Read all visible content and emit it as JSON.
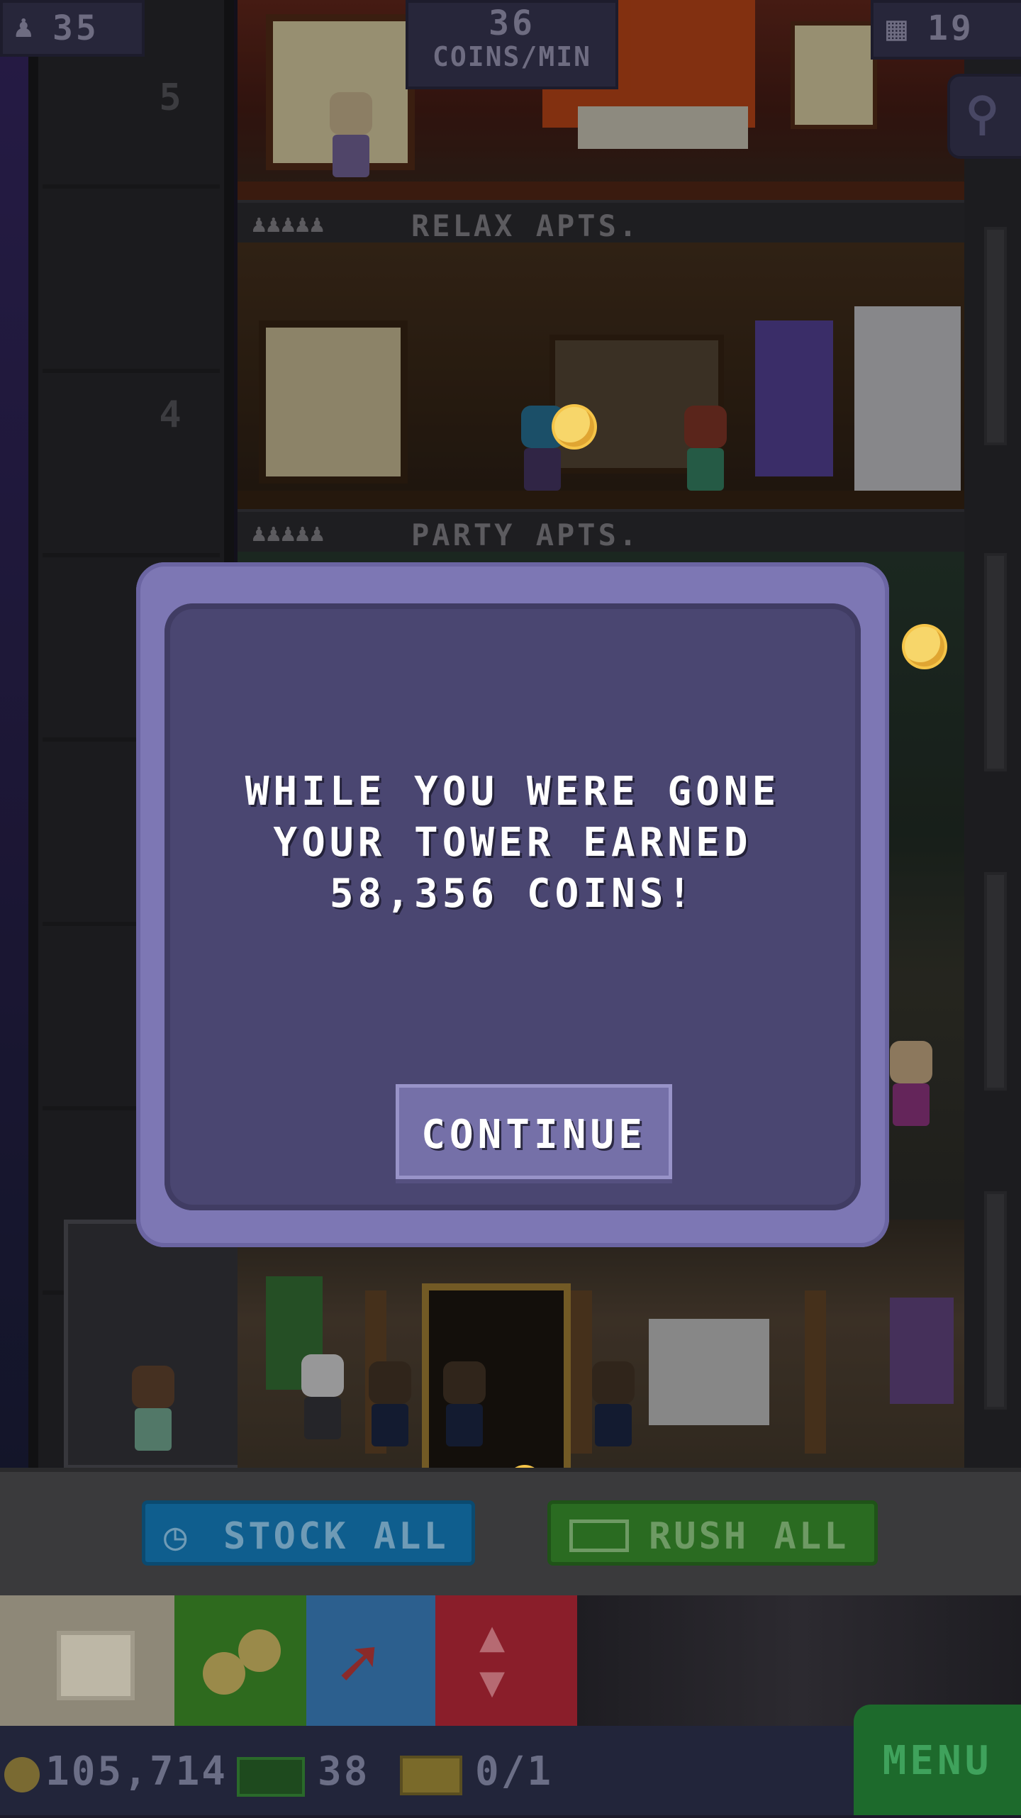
{
  "hud": {
    "population": "35",
    "coins_per_min_value": "36",
    "coins_per_min_label": "COINS/MIN",
    "floor_count": "19"
  },
  "floors": {
    "numbers": [
      "5",
      "4"
    ],
    "labels": [
      {
        "people": "♟♟♟♟♟",
        "name": "RELAX APTS."
      },
      {
        "people": "♟♟♟♟♟",
        "name": "PARTY APTS."
      }
    ]
  },
  "dialog": {
    "message": "WHILE YOU WERE GONE YOUR TOWER EARNED 58,356 COINS!",
    "continue_label": "CONTINUE"
  },
  "actions": {
    "stock_all": "STOCK ALL",
    "rush_all": "RUSH ALL"
  },
  "toolbar": {
    "tools": [
      {
        "icon": "box-icon"
      },
      {
        "icon": "coins-icon"
      },
      {
        "icon": "red-arrow-icon"
      },
      {
        "icon": "elevator-arrows-icon"
      }
    ]
  },
  "bottom": {
    "coins": "105,714",
    "bux": "38",
    "tickets": "0/1",
    "menu_label": "MENU"
  },
  "colors": {
    "dialog_outer": "#7d77b4",
    "dialog_inner": "#4a4671",
    "stock_blue": "#0f5e8e",
    "rush_green": "#2a6b21",
    "menu_green": "#1d6a2c",
    "coin_gold": "#f7d66a"
  }
}
